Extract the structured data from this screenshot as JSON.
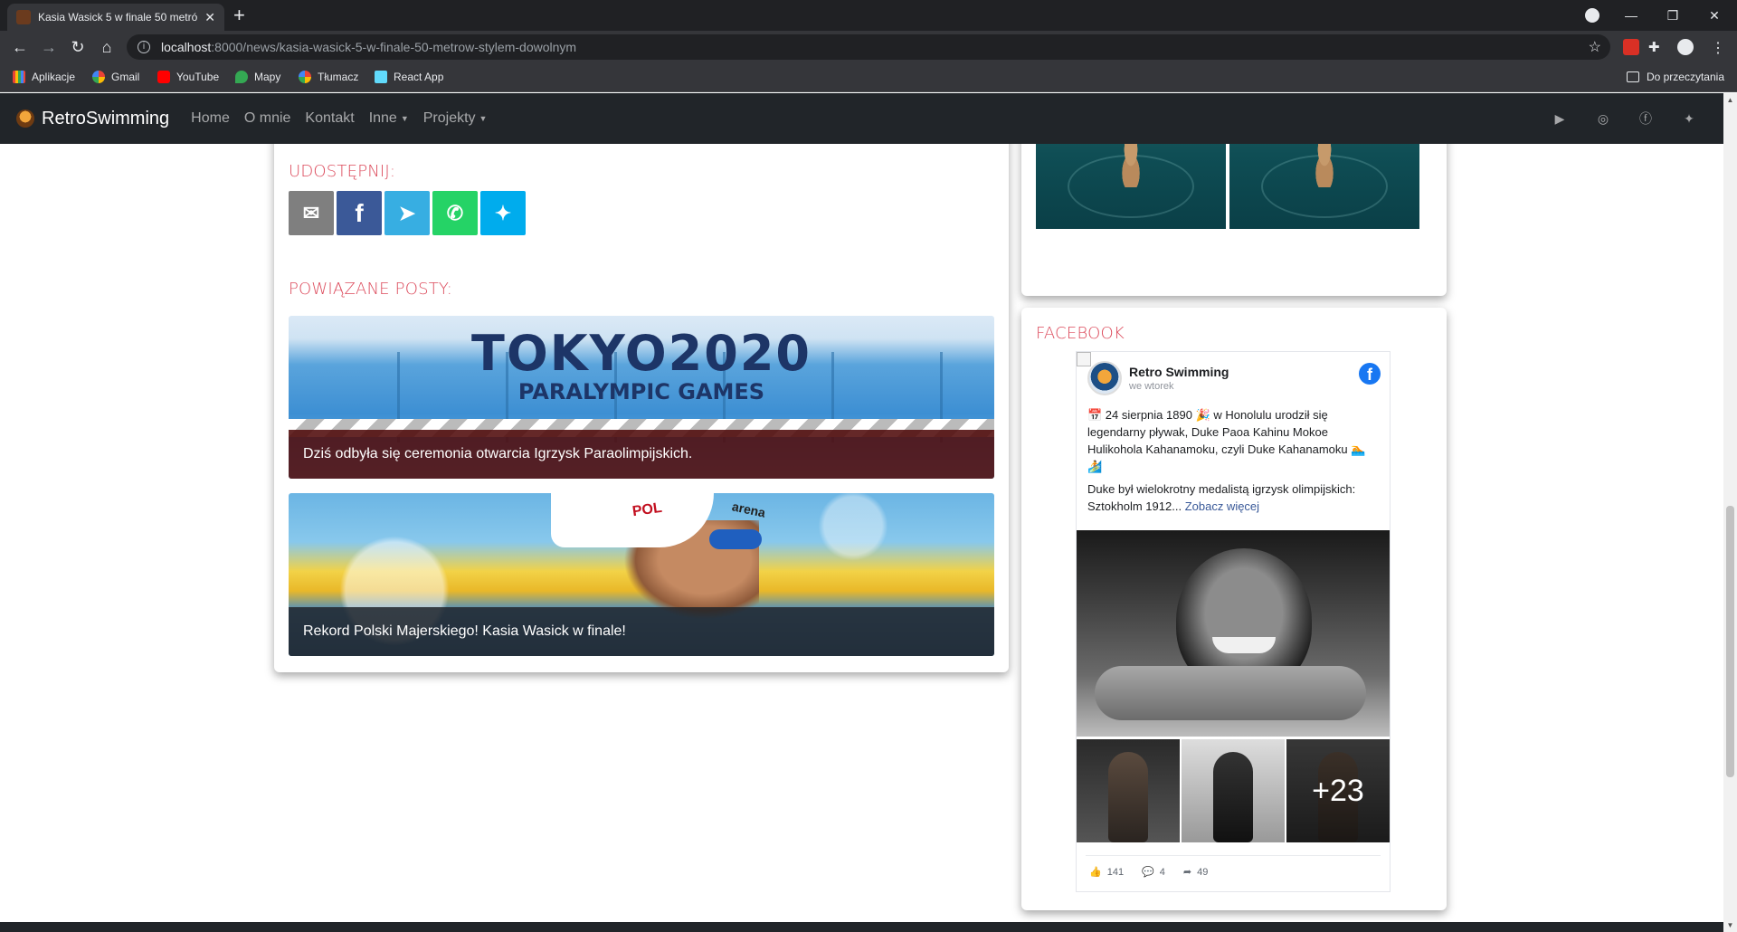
{
  "browser": {
    "tab_title": "Kasia Wasick 5 w finale 50 metró",
    "tab_close": "✕",
    "new_tab": "+",
    "url_host": "localhost",
    "url_path": ":8000/news/kasia-wasick-5-w-finale-50-metrow-stylem-dowolnym",
    "bookmarks": [
      {
        "label": "Aplikacje",
        "icon": "apps-grid-icon",
        "color": "#ea4335"
      },
      {
        "label": "Gmail",
        "icon": "google-icon",
        "color": "#ffffff"
      },
      {
        "label": "YouTube",
        "icon": "youtube-icon",
        "color": "#ff0000"
      },
      {
        "label": "Mapy",
        "icon": "maps-pin-icon",
        "color": "#34a853"
      },
      {
        "label": "Tłumacz",
        "icon": "google-icon",
        "color": "#ffffff"
      },
      {
        "label": "React App",
        "icon": "react-icon",
        "color": "#61dafb"
      }
    ],
    "reading_list": "Do przeczytania"
  },
  "site": {
    "brand": "RetroSwimming",
    "nav": {
      "home": "Home",
      "about": "O mnie",
      "contact": "Kontakt",
      "other": "Inne",
      "projects": "Projekty"
    },
    "social_icons": [
      "youtube-icon",
      "instagram-icon",
      "facebook-icon",
      "twitter-icon"
    ]
  },
  "article": {
    "share_title": "UDOSTĘPNIJ:",
    "share_buttons": [
      {
        "name": "email",
        "glyph": "✉",
        "color": "#7f7f7f"
      },
      {
        "name": "facebook",
        "glyph": "f",
        "color": "#3b5998"
      },
      {
        "name": "telegram",
        "glyph": "➤",
        "color": "#37aee2"
      },
      {
        "name": "whatsapp",
        "glyph": "✆",
        "color": "#25d366"
      },
      {
        "name": "twitter",
        "glyph": "🐦",
        "color": "#00aced"
      }
    ],
    "related_title": "POWIĄZANE POSTY:",
    "related_posts": [
      {
        "caption": "Dziś odbyła się ceremonia otwarcia Igrzysk Paraolimpijskich.",
        "image_text_main": "TOKYO2020",
        "image_text_sub": "PARALYMPIC GAMES"
      },
      {
        "caption": "Rekord Polski Majerskiego! Kasia Wasick w finale!",
        "cap_text": "POL",
        "cap_brand": "arena"
      }
    ]
  },
  "sidebar": {
    "facebook_title": "FACEBOOK",
    "fb_post": {
      "page_name": "Retro Swimming",
      "time": "we wtorek",
      "text_1": "📅 24 sierpnia 1890 🎉 w Honolulu urodził się legendarny pływak, Duke Paoa Kahinu Mokoe Hulikohola Kahanamoku, czyli Duke Kahanamoku 🏊🏄",
      "text_2": "Duke był wielokrotny medalistą igrzysk olimpijskich: Sztokholm 1912...",
      "see_more": "Zobacz więcej",
      "more_photos": "+23",
      "likes": "141",
      "comments": "4",
      "shares": "49"
    }
  }
}
